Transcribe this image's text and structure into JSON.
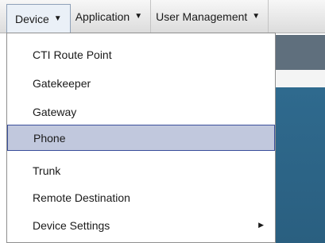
{
  "menubar": {
    "menus": [
      {
        "label": "Device",
        "caret": "▼"
      },
      {
        "label": "Application",
        "caret": "▼"
      },
      {
        "label": "User Management",
        "caret": "▼"
      }
    ]
  },
  "device_menu": {
    "items": [
      {
        "label": "CTI Route Point"
      },
      {
        "label": "Gatekeeper"
      },
      {
        "label": "Gateway"
      },
      {
        "label": "Phone",
        "selected": true
      },
      {
        "label": "Trunk"
      },
      {
        "label": "Remote Destination"
      },
      {
        "label": "Device Settings",
        "has_submenu": true,
        "submenu_glyph": "▶"
      }
    ]
  },
  "icons": {
    "caret": "chevron-down-icon",
    "submenu": "chevron-right-icon"
  },
  "colors": {
    "selection_fill": "#c1c8dd",
    "selection_border": "#3a4f9b",
    "app_blue": "#2f6a8e"
  }
}
